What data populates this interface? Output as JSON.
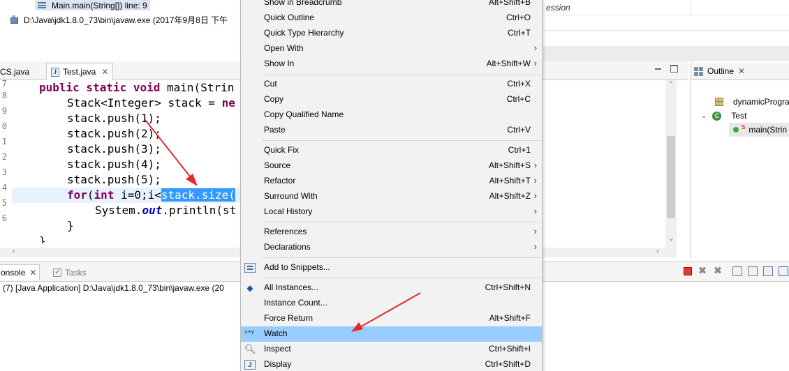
{
  "debug": {
    "frame_label": "Main.main(String[]) line: 9",
    "process_label": "D:\\Java\\jdk1.8.0_73\\bin\\javaw.exe (2017年9月8日 下午",
    "expressions_fragment": "ession"
  },
  "editor": {
    "tabs": [
      {
        "label": "CS.java",
        "active": false
      },
      {
        "label": "Test.java",
        "active": true
      }
    ],
    "line_numbers": [
      "7",
      "8",
      "9",
      "0",
      "1",
      "2",
      "3",
      "4",
      "5",
      "6",
      "7"
    ],
    "code": {
      "l1": [
        "public static void",
        " main(Strin"
      ],
      "l2": "Stack<Integer> stack = ",
      "l2_kw": "ne",
      "l3": "stack.push(1);",
      "l4": "stack.push(2);",
      "l5": "stack.push(3);",
      "l6": "stack.push(4);",
      "l7": "stack.push(5);",
      "l8_kw1": "for",
      "l8_a": "(",
      "l8_kw2": "int",
      "l8_b": " i=0;i<",
      "l8_sel": "stack.size(",
      "l9_a": "System.",
      "l9_fld": "out",
      "l9_b": ".println(st",
      "l10": "}",
      "l11": "}"
    }
  },
  "outline": {
    "tab_label": "Outline",
    "items": [
      {
        "label": "dynamicProgra",
        "kind": "package"
      },
      {
        "label": "Test",
        "kind": "class"
      },
      {
        "label": "main(Strin",
        "kind": "method",
        "modifier": "S"
      }
    ]
  },
  "console": {
    "tabs": [
      {
        "label": "onsole",
        "active": true
      },
      {
        "label": "Tasks",
        "active": false
      }
    ],
    "line": "(7) [Java Application] D:\\Java\\jdk1.8.0_73\\bin\\javaw.exe (20"
  },
  "context_menu": {
    "items": [
      {
        "label": "Show in Breadcrumb",
        "accel": "Alt+Shift+B",
        "submenu": false
      },
      {
        "label": "Quick Outline",
        "accel": "Ctrl+O",
        "submenu": false
      },
      {
        "label": "Quick Type Hierarchy",
        "accel": "Ctrl+T",
        "submenu": false
      },
      {
        "label": "Open With",
        "accel": "",
        "submenu": true
      },
      {
        "label": "Show In",
        "accel": "Alt+Shift+W",
        "submenu": true
      },
      {
        "label": "Cut",
        "accel": "Ctrl+X",
        "submenu": false
      },
      {
        "label": "Copy",
        "accel": "Ctrl+C",
        "submenu": false
      },
      {
        "label": "Copy Qualified Name",
        "accel": "",
        "submenu": false
      },
      {
        "label": "Paste",
        "accel": "Ctrl+V",
        "submenu": false
      },
      {
        "label": "Quick Fix",
        "accel": "Ctrl+1",
        "submenu": false
      },
      {
        "label": "Source",
        "accel": "Alt+Shift+S",
        "submenu": true
      },
      {
        "label": "Refactor",
        "accel": "Alt+Shift+T",
        "submenu": true
      },
      {
        "label": "Surround With",
        "accel": "Alt+Shift+Z",
        "submenu": true
      },
      {
        "label": "Local History",
        "accel": "",
        "submenu": true
      },
      {
        "label": "References",
        "accel": "",
        "submenu": true
      },
      {
        "label": "Declarations",
        "accel": "",
        "submenu": true
      },
      {
        "label": "Add to Snippets...",
        "accel": "",
        "submenu": false
      },
      {
        "label": "All Instances...",
        "accel": "Ctrl+Shift+N",
        "submenu": false
      },
      {
        "label": "Instance Count...",
        "accel": "",
        "submenu": false
      },
      {
        "label": "Force Return",
        "accel": "Alt+Shift+F",
        "submenu": false
      },
      {
        "label": "Watch",
        "accel": "",
        "submenu": false,
        "highlighted": true
      },
      {
        "label": "Inspect",
        "accel": "Ctrl+Shift+I",
        "submenu": false
      },
      {
        "label": "Display",
        "accel": "Ctrl+Shift+D",
        "submenu": false
      }
    ],
    "watch_icon_text": "x+y",
    "display_icon_text": "J",
    "submenu_glyph": "›"
  },
  "colors": {
    "highlight": "#99ccff",
    "selection": "#3399ff",
    "keyword": "#7f0055",
    "annotation_red": "#e8262a"
  }
}
